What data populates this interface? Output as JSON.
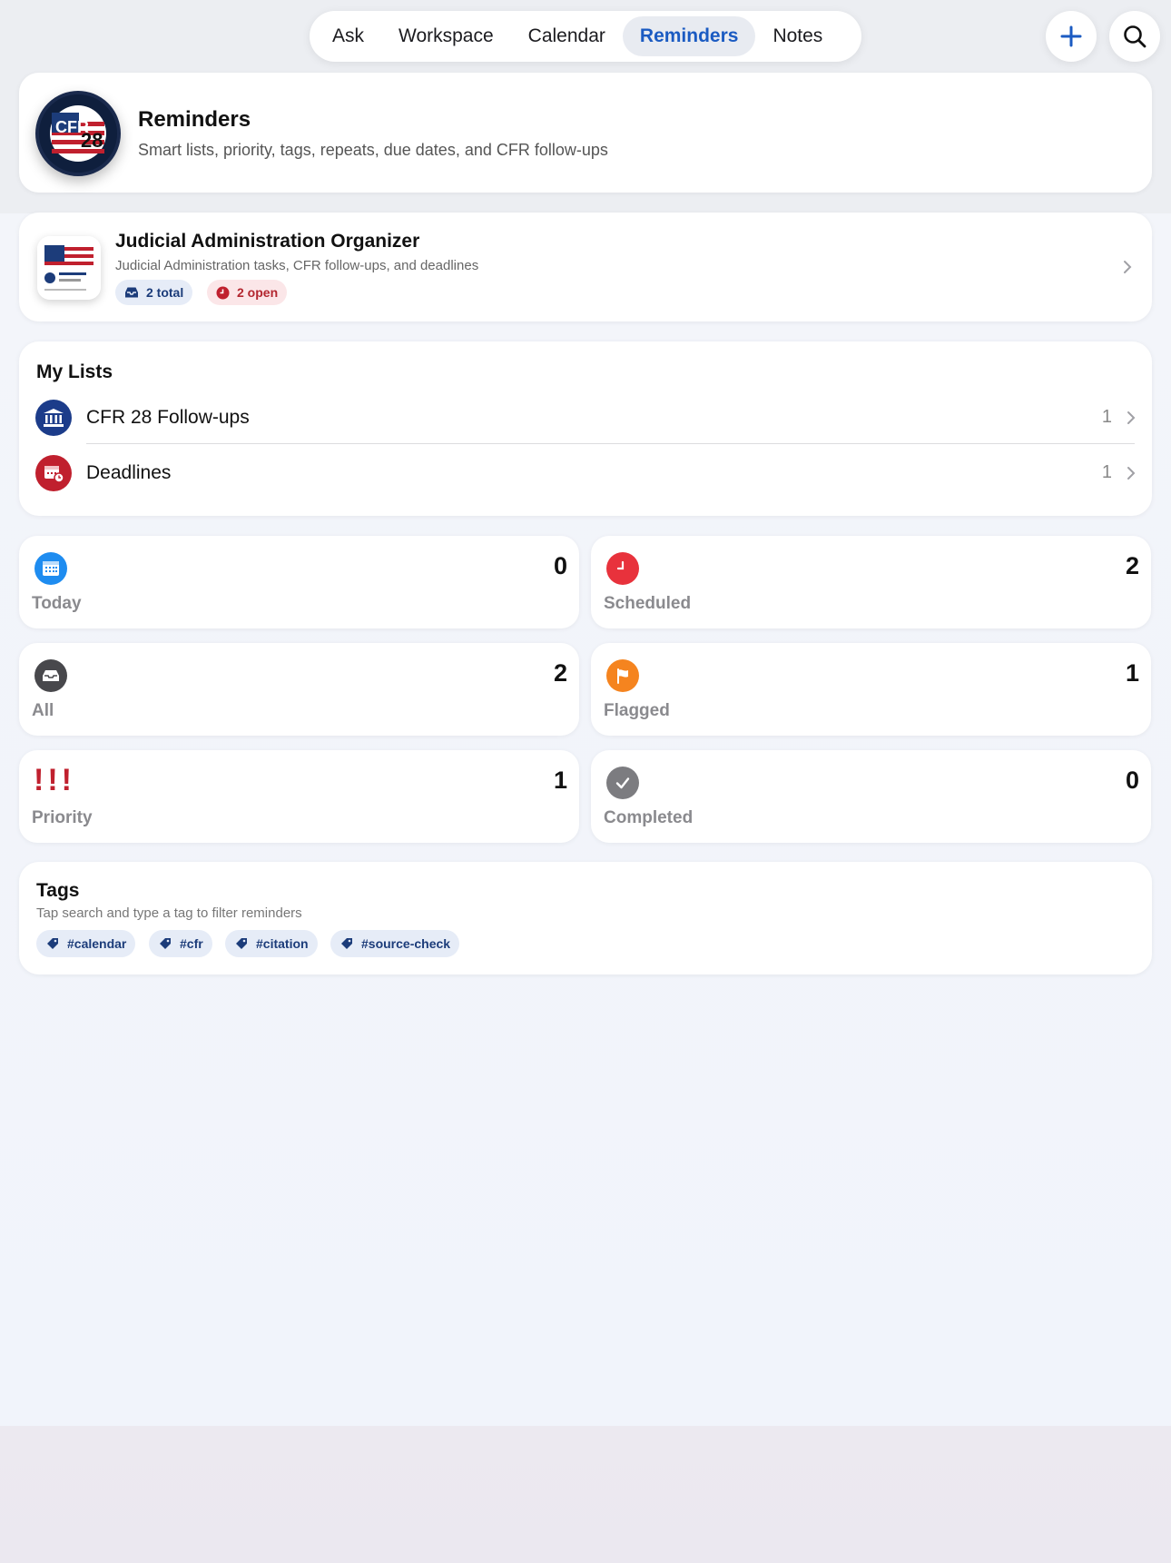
{
  "nav": {
    "tabs": [
      {
        "label": "Ask"
      },
      {
        "label": "Workspace"
      },
      {
        "label": "Calendar"
      },
      {
        "label": "Reminders",
        "active": true
      },
      {
        "label": "Notes"
      }
    ],
    "add_icon": "plus-icon",
    "search_icon": "magnifier-icon"
  },
  "header": {
    "title": "Reminders",
    "subtitle": "Smart lists, priority, tags, repeats, due dates, and CFR follow-ups",
    "logo_text": "CFR",
    "logo_number": "28"
  },
  "organizer": {
    "title": "Judicial Administration Organizer",
    "subtitle": "Judicial Administration tasks, CFR follow-ups, and deadlines",
    "total_label": "2 total",
    "open_label": "2 open"
  },
  "my_lists": {
    "title": "My Lists",
    "items": [
      {
        "label": "CFR 28 Follow-ups",
        "count": "1",
        "icon": "courthouse-icon",
        "color": "#1c3c8a"
      },
      {
        "label": "Deadlines",
        "count": "1",
        "icon": "calendar-clock-icon",
        "color": "#c0202e"
      }
    ]
  },
  "smart_lists": [
    {
      "label": "Today",
      "count": "0",
      "icon": "calendar-icon",
      "color": "#1e8cf0"
    },
    {
      "label": "Scheduled",
      "count": "2",
      "icon": "clock-icon",
      "color": "#e8323c"
    },
    {
      "label": "All",
      "count": "2",
      "icon": "tray-icon",
      "color": "#48484c"
    },
    {
      "label": "Flagged",
      "count": "1",
      "icon": "flag-icon",
      "color": "#f5841f"
    },
    {
      "label": "Priority",
      "count": "1",
      "icon": "exclamation-icon",
      "color": "#c0202e",
      "glyph": "!!!"
    },
    {
      "label": "Completed",
      "count": "0",
      "icon": "checkmark-icon",
      "color": "#7c7c80"
    }
  ],
  "tags": {
    "title": "Tags",
    "subtitle": "Tap search and type a tag to filter reminders",
    "items": [
      {
        "label": "#calendar"
      },
      {
        "label": "#cfr"
      },
      {
        "label": "#citation"
      },
      {
        "label": "#source-check"
      }
    ]
  },
  "colors": {
    "accent": "#1b5bc2",
    "navy": "#1c3c7a",
    "red": "#c0202e"
  }
}
